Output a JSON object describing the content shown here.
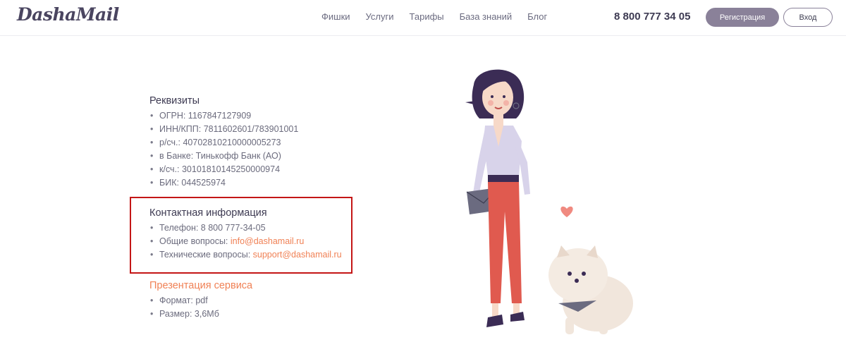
{
  "header": {
    "logo": "DashaMail",
    "nav": [
      "Фишки",
      "Услуги",
      "Тарифы",
      "База знаний",
      "Блог"
    ],
    "phone": "8 800 777 34 05",
    "register_label": "Регистрация",
    "login_label": "Вход"
  },
  "requisites": {
    "title": "Реквизиты",
    "items": [
      "ОГРН: 1167847127909",
      "ИНН/КПП: 7811602601/783901001",
      "р/сч.: 40702810210000005273",
      "в Банке: Тинькофф Банк (АО)",
      "к/сч.: 30101810145250000974",
      "БИК: 044525974"
    ]
  },
  "contacts": {
    "title": "Контактная информация",
    "phone": "Телефон: 8 800 777-34-05",
    "general_label": "Общие вопросы: ",
    "general_email": "info@dashamail.ru",
    "tech_label": "Технические вопросы: ",
    "tech_email": "support@dashamail.ru"
  },
  "presentation": {
    "title": "Презентация сервиса",
    "items": [
      "Формат: pdf",
      "Размер: 3,6Мб"
    ]
  },
  "colors": {
    "accent": "#f08155",
    "button": "#8a8199",
    "highlight_box": "#c41616"
  },
  "illustration": "woman-with-dog"
}
